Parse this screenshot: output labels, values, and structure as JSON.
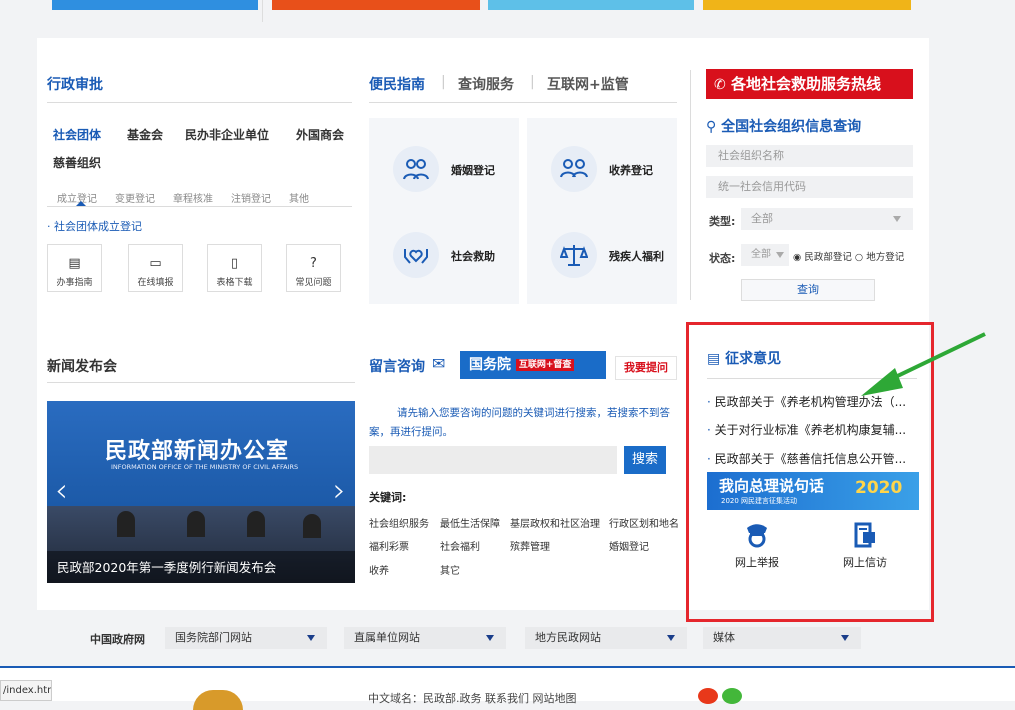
{
  "admin": {
    "title": "行政审批",
    "categories": [
      "社会团体",
      "基金会",
      "民办非企业单位",
      "外国商会",
      "慈善组织"
    ],
    "subtabs": [
      "成立登记",
      "变更登记",
      "章程核准",
      "注销登记",
      "其他"
    ],
    "link": "社会团体成立登记",
    "actions": [
      "办事指南",
      "在线填报",
      "表格下载",
      "常见问题"
    ]
  },
  "service": {
    "tabs": [
      "便民指南",
      "查询服务",
      "互联网+监管"
    ],
    "items": [
      "婚姻登记",
      "收养登记",
      "社会救助",
      "残疾人福利"
    ]
  },
  "hotline": {
    "banner": "各地社会救助服务热线",
    "query_title": "全国社会组织信息查询",
    "name_placeholder": "社会组织名称",
    "code_placeholder": "统一社会信用代码",
    "type_label": "类型:",
    "type_value": "全部",
    "status_label": "状态:",
    "status_value": "全部",
    "radio1": "民政部登记",
    "radio2": "地方登记",
    "query_button": "查询"
  },
  "press": {
    "title": "新闻发布会",
    "screen_title": "民政部新闻办公室",
    "screen_subtitle": "INFORMATION OFFICE OF THE MINISTRY OF CIVIL AFFAIRS",
    "caption": "民政部2020年第一季度例行新闻发布会"
  },
  "consult": {
    "title": "留言咨询",
    "banner_a": "国务院",
    "banner_b": "互联网+督查",
    "ask_button": "我要提问",
    "prompt": "请先输入您要咨询的问题的关键词进行搜索，若搜索不到答案，再进行提问。",
    "search_button": "搜索",
    "keywords_label": "关键词:",
    "keywords": [
      "社会组织服务",
      "最低生活保障",
      "基层政权和社区治理",
      "行政区划和地名",
      "福利彩票",
      "社会福利",
      "殡葬管理",
      "婚姻登记",
      "收养",
      "其它"
    ]
  },
  "opinion": {
    "title": "征求意见",
    "items": [
      "民政部关于《养老机构管理办法（...",
      "关于对行业标准《养老机构康复辅...",
      "民政部关于《慈善信托信息公开管..."
    ],
    "banner_text": "我向总理说句话",
    "banner_sub": "2020 网民建言征集活动",
    "banner_year": "2020",
    "report": "网上举报",
    "letter": "网上信访"
  },
  "footer": {
    "gov_label": "中国政府网",
    "dropdowns": [
      "国务院部门网站",
      "直属单位网站",
      "地方民政网站",
      "媒体"
    ],
    "bottom_text": "中文域名：民政部.政务   联系我们   网站地图",
    "status_url": "/index.htm"
  },
  "colors": {
    "accent": "#1a5bb5",
    "hotline_red": "#d8101c",
    "annotation_red": "#e5262d",
    "arrow_green": "#2ea836"
  }
}
